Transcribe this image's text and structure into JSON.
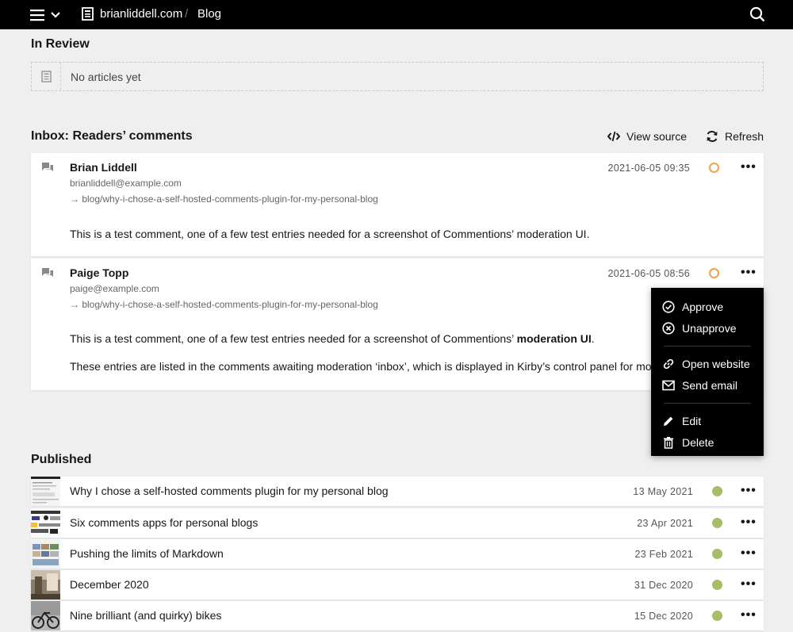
{
  "header": {
    "site_name": "brianliddell.com",
    "separator": "/",
    "page_name": "Blog"
  },
  "in_review": {
    "title": "In Review",
    "empty_text": "No articles yet"
  },
  "inbox": {
    "title": "Inbox: Readers’ comments",
    "view_source_label": "View source",
    "refresh_label": "Refresh",
    "comments": [
      {
        "author": "Brian Liddell",
        "email": "brianliddell@example.com",
        "link": "→ blog/why-i-chose-a-self-hosted-comments-plugin-for-my-personal-blog",
        "date": "2021-06-05 09:35",
        "body_1": "This is a test comment, one of a few test entries needed for a screenshot of Commentions’ moderation UI."
      },
      {
        "author": "Paige Topp",
        "email": "paige@example.com",
        "link": "→ blog/why-i-chose-a-self-hosted-comments-plugin-for-my-personal-blog",
        "date": "2021-06-05 08:56",
        "body_1_prefix": "This is a test comment, one of a few test entries needed for a screenshot of Commentions’ ",
        "body_1_bold": "moderation UI",
        "body_1_suffix": ".",
        "body_2": "These entries are listed in the comments awaiting moderation ‘inbox’, which is displayed in Kirby’s control panel for moderation."
      }
    ]
  },
  "dropdown": {
    "approve": "Approve",
    "unapprove": "Unapprove",
    "open_website": "Open website",
    "send_email": "Send email",
    "edit": "Edit",
    "delete": "Delete"
  },
  "published": {
    "title": "Published",
    "items": [
      {
        "title": "Why I chose a self-hosted comments plugin for my personal blog",
        "date": "13 May 2021"
      },
      {
        "title": "Six comments apps for personal blogs",
        "date": "23 Apr 2021"
      },
      {
        "title": "Pushing the limits of Markdown",
        "date": "23 Feb 2021"
      },
      {
        "title": "December 2020",
        "date": "31 Dec 2020"
      },
      {
        "title": "Nine brilliant (and quirky) bikes",
        "date": "15 Dec 2020"
      }
    ]
  },
  "colors": {
    "topbar": "#000000",
    "background": "#efefef",
    "status_pending": "#f0a24a",
    "status_published": "#a7bd68"
  },
  "icons": {
    "menu": "hamburger-icon",
    "caret": "chevron-down-icon",
    "site": "page-icon",
    "search": "search-icon",
    "comment": "chat-icon",
    "code": "code-icon",
    "refresh": "refresh-icon"
  },
  "more_label": "•••"
}
